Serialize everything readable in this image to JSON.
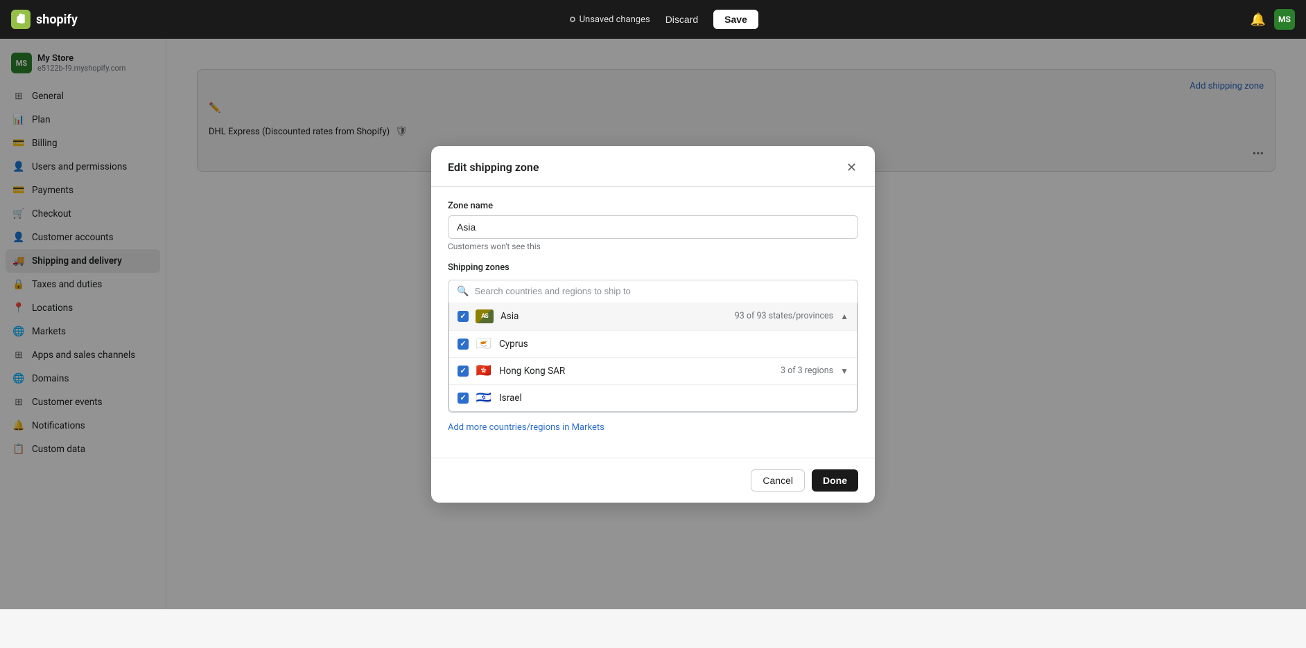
{
  "topbar": {
    "logo_text": "shopify",
    "unsaved_label": "Unsaved changes",
    "discard_label": "Discard",
    "save_label": "Save",
    "avatar_initials": "MS"
  },
  "sidebar": {
    "store_name": "My Store",
    "store_url": "e5122b-f9.myshopify.com",
    "store_initials": "MS",
    "nav_items": [
      {
        "id": "general",
        "label": "General",
        "icon": "⊞"
      },
      {
        "id": "plan",
        "label": "Plan",
        "icon": "📊"
      },
      {
        "id": "billing",
        "label": "Billing",
        "icon": "💳"
      },
      {
        "id": "users",
        "label": "Users and permissions",
        "icon": "👤"
      },
      {
        "id": "payments",
        "label": "Payments",
        "icon": "💳"
      },
      {
        "id": "checkout",
        "label": "Checkout",
        "icon": "🛒"
      },
      {
        "id": "customer-accounts",
        "label": "Customer accounts",
        "icon": "👤"
      },
      {
        "id": "shipping",
        "label": "Shipping and delivery",
        "icon": "🚚"
      },
      {
        "id": "taxes",
        "label": "Taxes and duties",
        "icon": "🔒"
      },
      {
        "id": "locations",
        "label": "Locations",
        "icon": "📍"
      },
      {
        "id": "markets",
        "label": "Markets",
        "icon": "🌐"
      },
      {
        "id": "apps",
        "label": "Apps and sales channels",
        "icon": "⊞"
      },
      {
        "id": "domains",
        "label": "Domains",
        "icon": "🌐"
      },
      {
        "id": "customer-events",
        "label": "Customer events",
        "icon": "⊞"
      },
      {
        "id": "notifications",
        "label": "Notifications",
        "icon": "🔔"
      },
      {
        "id": "custom-data",
        "label": "Custom data",
        "icon": "📋"
      }
    ]
  },
  "modal": {
    "title": "Edit shipping zone",
    "zone_name_label": "Zone name",
    "zone_name_value": "Asia",
    "zone_name_hint": "Customers won't see this",
    "shipping_zones_label": "Shipping zones",
    "search_placeholder": "Search countries and regions to ship to",
    "countries": [
      {
        "id": "asia",
        "name": "Asia",
        "meta": "93 of 93 states/provinces",
        "has_chevron_up": true,
        "flag_type": "text",
        "flag_text": "AS",
        "flag_bg": "#8B8000",
        "checked": true,
        "highlighted": true
      },
      {
        "id": "cyprus",
        "name": "Cyprus",
        "meta": "",
        "has_chevron_up": false,
        "flag_type": "emoji",
        "flag_emoji": "🇨🇾",
        "checked": true,
        "highlighted": false
      },
      {
        "id": "hongkong",
        "name": "Hong Kong SAR",
        "meta": "3 of 3 regions",
        "has_chevron_up": false,
        "has_chevron_down": true,
        "flag_type": "emoji",
        "flag_emoji": "🇭🇰",
        "checked": true,
        "highlighted": false
      },
      {
        "id": "israel",
        "name": "Israel",
        "meta": "",
        "flag_type": "emoji",
        "flag_emoji": "🇮🇱",
        "checked": true,
        "highlighted": false
      }
    ],
    "add_markets_link": "Add more countries/regions in Markets",
    "cancel_label": "Cancel",
    "done_label": "Done"
  },
  "background": {
    "add_zone_label": "Add shipping zone",
    "dhl_label": "DHL Express (Discounted rates from Shopify)"
  }
}
